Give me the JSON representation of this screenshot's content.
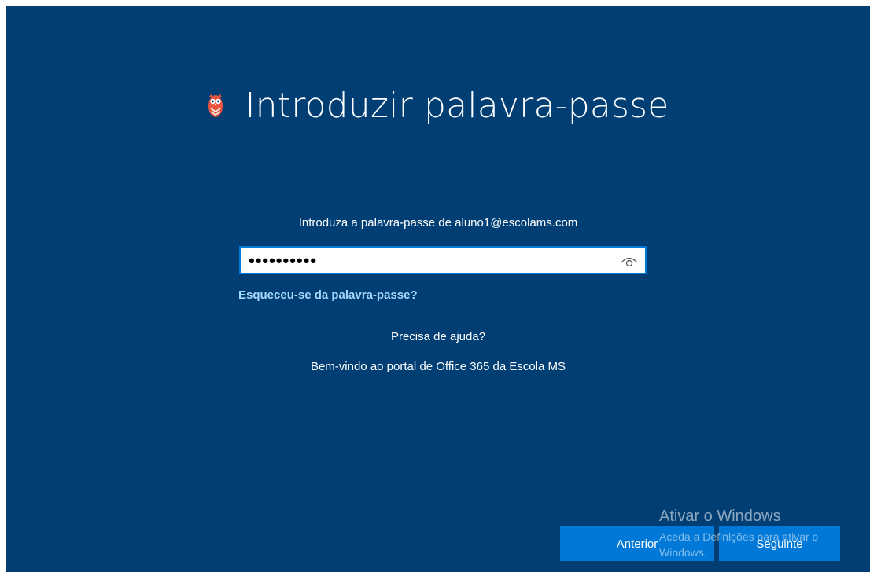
{
  "header": {
    "title": "Introduzir palavra-passe",
    "logo_icon": "owl-icon",
    "logo_color": "#e8543f"
  },
  "form": {
    "prompt": "Introduza a palavra-passe de aluno1@escolams.com",
    "password_masked": "••••••••••",
    "reveal_icon": "eye-icon",
    "forgot_link": "Esqueceu-se da palavra-passe?"
  },
  "help": {
    "label": "Precisa de ajuda?"
  },
  "welcome": {
    "text": "Bem-vindo ao portal de Office 365 da Escola MS"
  },
  "footer": {
    "back_label": "Anterior",
    "next_label": "Seguinte"
  },
  "watermark": {
    "title": "Ativar o Windows",
    "subtitle": "Aceda a Definições para ativar o Windows."
  },
  "colors": {
    "background": "#003e74",
    "button": "#0078d7",
    "link": "#a6d8ff"
  }
}
